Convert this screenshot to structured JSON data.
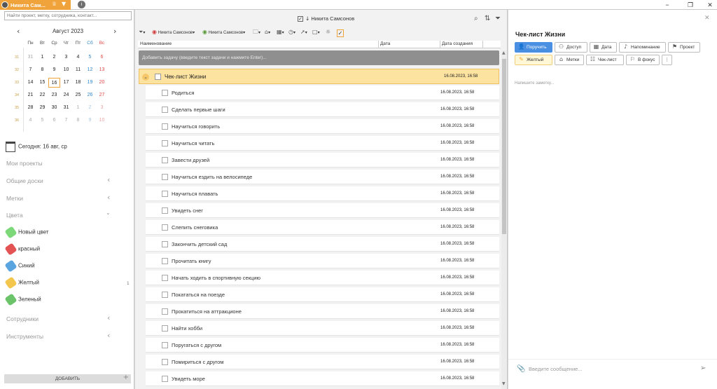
{
  "titlebar": {
    "user": "Никита Сам...",
    "info_icon": "info-circle-icon",
    "window_controls": [
      "minimize",
      "maximize",
      "close"
    ]
  },
  "left": {
    "search_placeholder": "Найти проект, метку, сотрудника, контакт...",
    "calendar": {
      "month": "Август 2023",
      "weekdays": [
        "Пн",
        "Вт",
        "Ср",
        "Чт",
        "Пт",
        "Сб",
        "Вс"
      ],
      "weeks": [
        {
          "num": "31",
          "days": [
            "31",
            "1",
            "2",
            "3",
            "4",
            "5",
            "6"
          ]
        },
        {
          "num": "32",
          "days": [
            "7",
            "8",
            "9",
            "10",
            "11",
            "12",
            "13"
          ]
        },
        {
          "num": "33",
          "days": [
            "14",
            "15",
            "16",
            "17",
            "18",
            "19",
            "20"
          ]
        },
        {
          "num": "34",
          "days": [
            "21",
            "22",
            "23",
            "24",
            "25",
            "26",
            "27"
          ]
        },
        {
          "num": "35",
          "days": [
            "28",
            "29",
            "30",
            "31",
            "1",
            "2",
            "3"
          ]
        },
        {
          "num": "36",
          "days": [
            "4",
            "5",
            "6",
            "7",
            "8",
            "9",
            "10"
          ]
        }
      ]
    },
    "today": "Сегодня: 16 авг, ср",
    "nav": {
      "projects": "Мои проекты",
      "boards": "Общие доски",
      "tags": "Метки",
      "colors": "Цвета",
      "staff": "Сотрудники",
      "tools": "Инструменты"
    },
    "colors": [
      {
        "label": "Новый цвет",
        "color": "#7dd87a"
      },
      {
        "label": "красный",
        "color": "#e45353"
      },
      {
        "label": "Синий",
        "color": "#5aa4e0"
      },
      {
        "label": "Желтый",
        "color": "#f3c64e"
      },
      {
        "label": "Зеленый",
        "color": "#6cc46a"
      }
    ],
    "yellow_count": "1",
    "add_button": "ДОБАВИТЬ"
  },
  "middle": {
    "filter": "Никита Самсонов",
    "toolbar": {
      "user1": "Никита Самсонов",
      "user2": "Никита Самсонов"
    },
    "columns": {
      "name": "Наименование",
      "date": "Дата",
      "created": "Дата создания"
    },
    "add_task_placeholder": "Добавить задачу (введите текст задачи и нажмите Enter)...",
    "group": {
      "title": "Чек-лист Жизни",
      "created": "16.08.2023, 16:58"
    },
    "tasks": [
      {
        "title": "Родиться",
        "created": "16.08.2023, 16:58"
      },
      {
        "title": "Сделать первые шаги",
        "created": "16.08.2023, 16:58"
      },
      {
        "title": "Научиться говорить",
        "created": "16.08.2023, 16:58"
      },
      {
        "title": "Научиться читать",
        "created": "16.08.2023, 16:58"
      },
      {
        "title": "Завести друзей",
        "created": "16.08.2023, 16:58"
      },
      {
        "title": "Научиться ездить на велосипеде",
        "created": "16.08.2023, 16:58"
      },
      {
        "title": "Научиться плавать",
        "created": "16.08.2023, 16:58"
      },
      {
        "title": "Увидеть снег",
        "created": "16.08.2023, 16:58"
      },
      {
        "title": "Слепить снеговика",
        "created": "16.08.2023, 16:58"
      },
      {
        "title": "Закончить детский сад",
        "created": "16.08.2023, 16:58"
      },
      {
        "title": "Прочитать книгу",
        "created": "16.08.2023, 16:58"
      },
      {
        "title": "Начать ходить в спортивную секцию",
        "created": "16.08.2023, 16:58"
      },
      {
        "title": "Покататься на поезде",
        "created": "16.08.2023, 16:58"
      },
      {
        "title": "Прокатиться на аттракционе",
        "created": "16.08.2023, 16:58"
      },
      {
        "title": "Найти хобби",
        "created": "16.08.2023, 16:58"
      },
      {
        "title": "Поругаться с другом",
        "created": "16.08.2023, 16:58"
      },
      {
        "title": "Помириться с другом",
        "created": "16.08.2023, 16:58"
      },
      {
        "title": "Увидеть море",
        "created": "16.08.2023, 16:58"
      }
    ]
  },
  "right": {
    "title": "Чек-лист Жизни",
    "buttons": {
      "assign": "Поручить",
      "access": "Доступ",
      "date": "Дата",
      "remind": "Напоминание",
      "project": "Проект",
      "yellow": "Желтый",
      "tags": "Метки",
      "checklist": "Чек-лист",
      "focus": "В фокус"
    },
    "note_placeholder": "Напишите заметку...",
    "message_placeholder": "Введите сообщение..."
  }
}
